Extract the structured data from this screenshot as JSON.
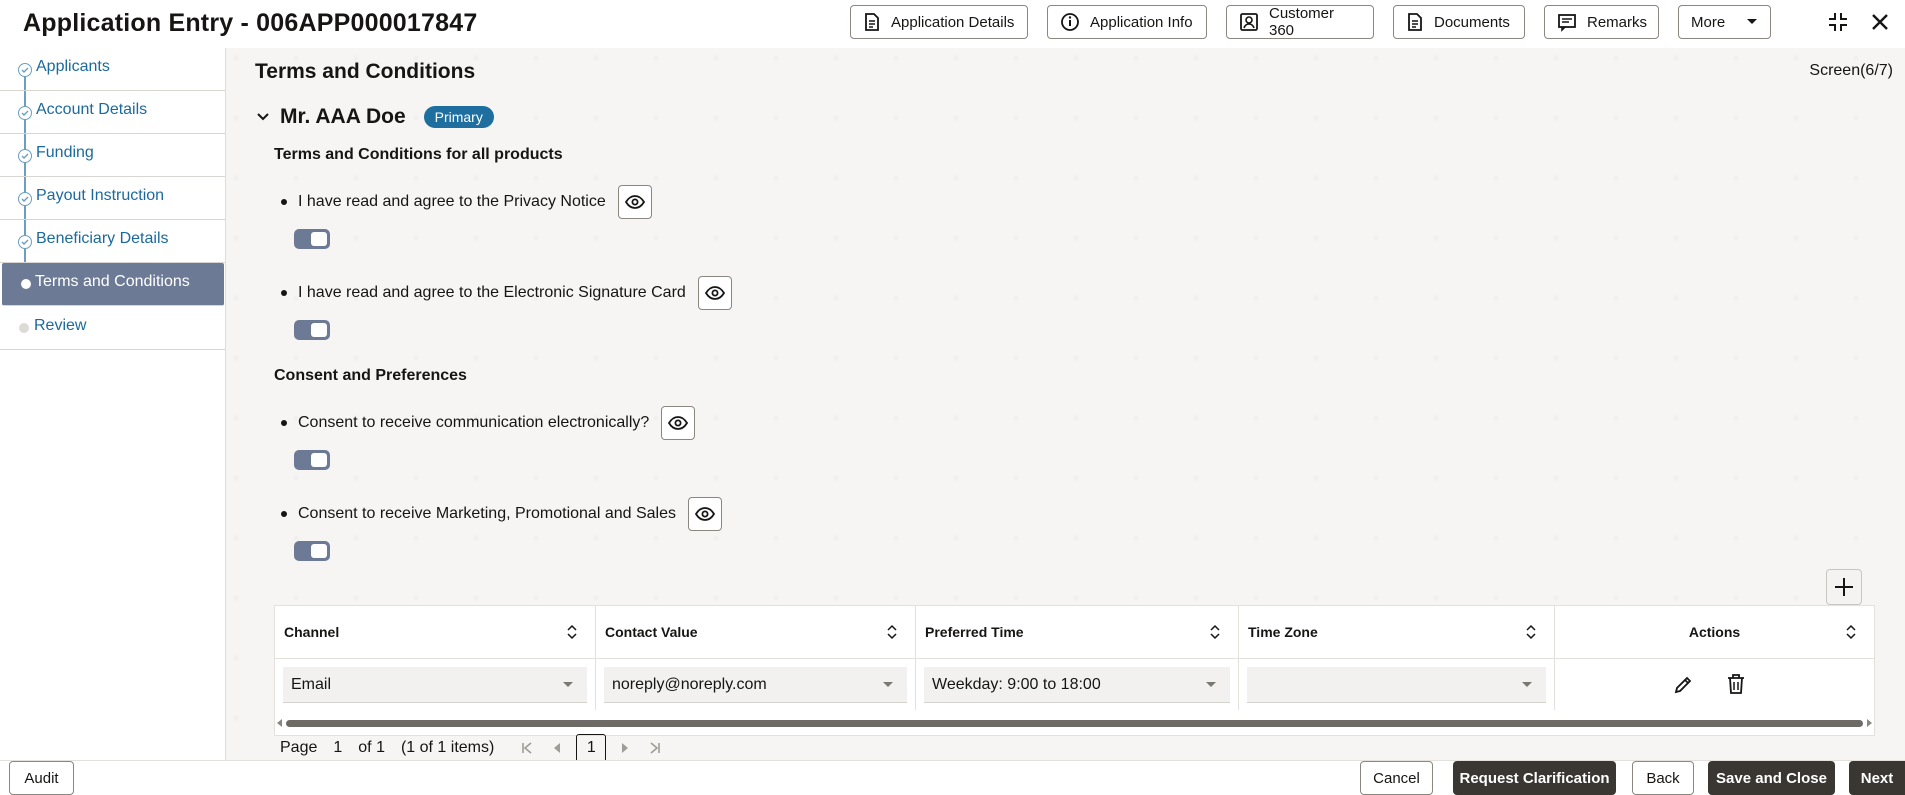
{
  "header": {
    "title": "Application Entry - 006APP000017847",
    "buttons": [
      {
        "label": "Application Details",
        "icon": "document-icon"
      },
      {
        "label": "Application Info",
        "icon": "info-icon"
      },
      {
        "label": "Customer 360",
        "icon": "person-card-icon"
      },
      {
        "label": "Documents",
        "icon": "documents-icon"
      },
      {
        "label": "Remarks",
        "icon": "remarks-icon"
      },
      {
        "label": "More",
        "icon": "caret-down-icon"
      }
    ]
  },
  "sidebar": {
    "items": [
      {
        "label": "Applicants",
        "state": "done"
      },
      {
        "label": "Account Details",
        "state": "done"
      },
      {
        "label": "Funding",
        "state": "done"
      },
      {
        "label": "Payout Instruction",
        "state": "done"
      },
      {
        "label": "Beneficiary Details",
        "state": "done"
      },
      {
        "label": "Terms and Conditions",
        "state": "active"
      },
      {
        "label": "Review",
        "state": "pending"
      }
    ]
  },
  "main": {
    "title": "Terms and Conditions",
    "screen_count": "Screen(6/7)",
    "applicant_name": "Mr. AAA Doe",
    "applicant_badge": "Primary",
    "section1_title": "Terms and Conditions for all products",
    "section2_title": "Consent and Preferences",
    "terms": [
      {
        "text": "I have read and agree to the Privacy Notice",
        "enabled": true
      },
      {
        "text": "I have read and agree to the Electronic Signature Card",
        "enabled": true
      }
    ],
    "consents": [
      {
        "text": "Consent to receive communication electronically?",
        "enabled": true
      },
      {
        "text": "Consent to receive Marketing, Promotional and Sales",
        "enabled": true
      }
    ]
  },
  "table": {
    "columns": [
      "Channel",
      "Contact Value",
      "Preferred Time",
      "Time Zone",
      "Actions"
    ],
    "rows": [
      {
        "channel": "Email",
        "contact_value": "noreply@noreply.com",
        "preferred_time": "Weekday: 9:00 to 18:00",
        "time_zone": ""
      }
    ]
  },
  "pager": {
    "page_label": "Page",
    "page_value": "1",
    "of_label": "of 1",
    "items_label": "(1 of 1 items)",
    "current": "1"
  },
  "footer": {
    "audit": "Audit",
    "cancel": "Cancel",
    "request_clarification": "Request Clarification",
    "back": "Back",
    "save_close": "Save and Close",
    "next": "Next"
  }
}
